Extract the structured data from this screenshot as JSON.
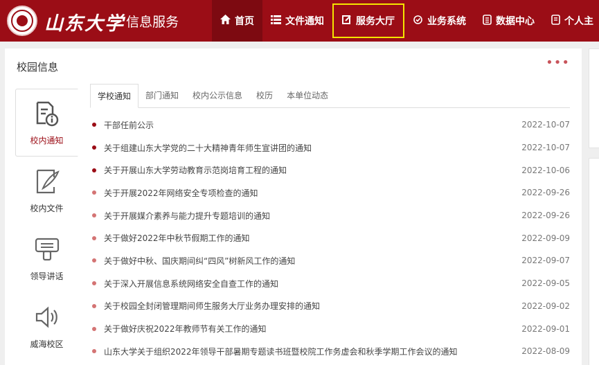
{
  "header": {
    "brand": "山东大学",
    "sub_brand": "· 信息服务",
    "nav": [
      {
        "label": "首页",
        "icon": "home-icon"
      },
      {
        "label": "文件通知",
        "icon": "list-icon"
      },
      {
        "label": "服务大厅",
        "icon": "edit-icon"
      },
      {
        "label": "业务系统",
        "icon": "settings-icon"
      },
      {
        "label": "数据中心",
        "icon": "database-icon"
      },
      {
        "label": "个人主",
        "icon": "profile-icon"
      }
    ]
  },
  "panel": {
    "title": "校园信息",
    "more": "•••",
    "side_tabs": [
      {
        "label": "校内通知",
        "icon": "notice-icon"
      },
      {
        "label": "校内文件",
        "icon": "document-pen-icon"
      },
      {
        "label": "领导讲话",
        "icon": "speech-icon"
      },
      {
        "label": "威海校区",
        "icon": "speaker-icon"
      }
    ],
    "tabs": [
      "学校通知",
      "部门通知",
      "校内公示信息",
      "校历",
      "本单位动态"
    ],
    "items": [
      {
        "title": "干部任前公示",
        "date": "2022-10-07"
      },
      {
        "title": "关于组建山东大学党的二十大精神青年师生宣讲团的通知",
        "date": "2022-10-07"
      },
      {
        "title": "关于开展山东大学劳动教育示范岗培育工程的通知",
        "date": "2022-10-06"
      },
      {
        "title": "关于开展2022年网络安全专项检查的通知",
        "date": "2022-09-26"
      },
      {
        "title": "关于开展媒介素养与能力提升专题培训的通知",
        "date": "2022-09-26"
      },
      {
        "title": "关于做好2022年中秋节假期工作的通知",
        "date": "2022-09-09"
      },
      {
        "title": "关于做好中秋、国庆期间纠“四风”树新风工作的通知",
        "date": "2022-09-07"
      },
      {
        "title": "关于深入开展信息系统网络安全自查工作的通知",
        "date": "2022-09-05"
      },
      {
        "title": "关于校园全封闭管理期间师生服务大厅业务办理安排的通知",
        "date": "2022-09-02"
      },
      {
        "title": "关于做好庆祝2022年教师节有关工作的通知",
        "date": "2022-09-01"
      },
      {
        "title": "山东大学关于组织2022年领导干部暑期专题读书班暨校院工作务虚会和秋季学期工作会议的通知",
        "date": "2022-08-09"
      }
    ]
  },
  "colors": {
    "brand": "#9b0d16",
    "highlight": "#f4e500"
  }
}
